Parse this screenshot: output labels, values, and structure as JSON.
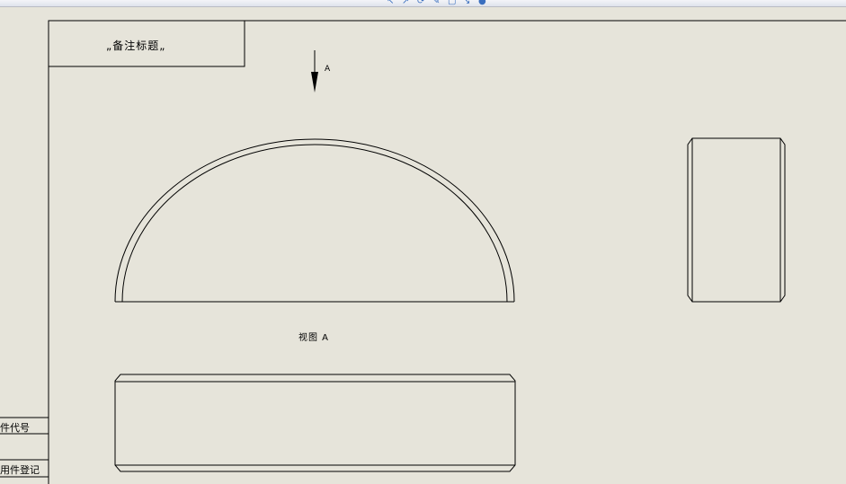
{
  "title_block": {
    "text": "„备注标题„"
  },
  "view_arrow": {
    "label": "A"
  },
  "view_caption": "视图 A",
  "side_table": {
    "rows": [
      "件代号",
      "用件登记"
    ]
  },
  "toolbar": {
    "icons": [
      "arrow-icon",
      "arrow-icon",
      "rotate-icon",
      "sketch-icon",
      "view-icon",
      "arrow-icon",
      "circle-icon"
    ]
  },
  "colors": {
    "sheet_background": "#e6e4da",
    "line": "#000000"
  }
}
